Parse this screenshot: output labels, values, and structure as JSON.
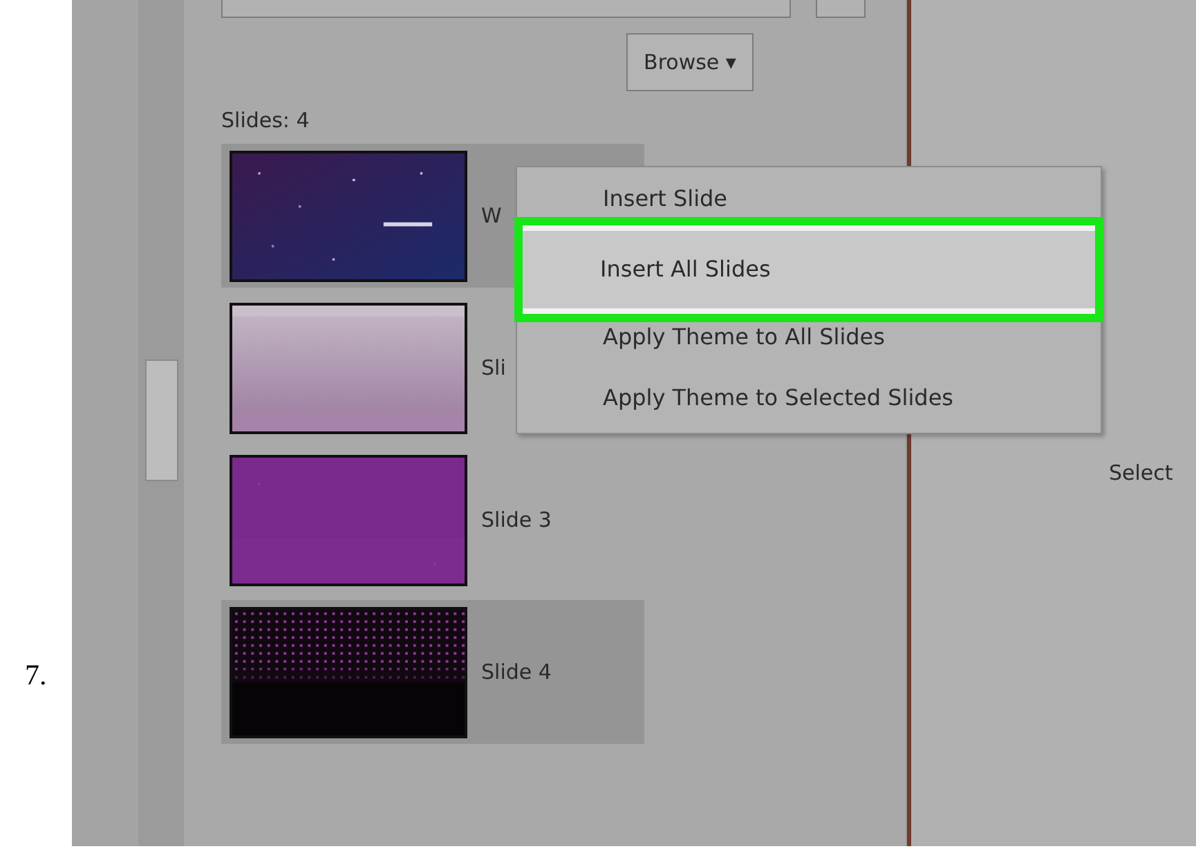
{
  "step_number": "7.",
  "panel": {
    "browse_button": "Browse ▾",
    "slides_count": "Slides: 4",
    "slides": [
      {
        "label": "W",
        "selected": true
      },
      {
        "label": "Sli",
        "selected": false
      },
      {
        "label": "Slide 3",
        "selected": false
      },
      {
        "label": "Slide 4",
        "selected": true
      }
    ]
  },
  "context_menu": [
    {
      "label": "Insert Slide",
      "selected": false
    },
    {
      "label": "Insert All Slides",
      "selected": true
    },
    {
      "label": "Apply Theme to All Slides",
      "selected": false
    },
    {
      "label": "Apply Theme to Selected Slides",
      "selected": false
    }
  ],
  "right_pane": {
    "text": "Select"
  }
}
